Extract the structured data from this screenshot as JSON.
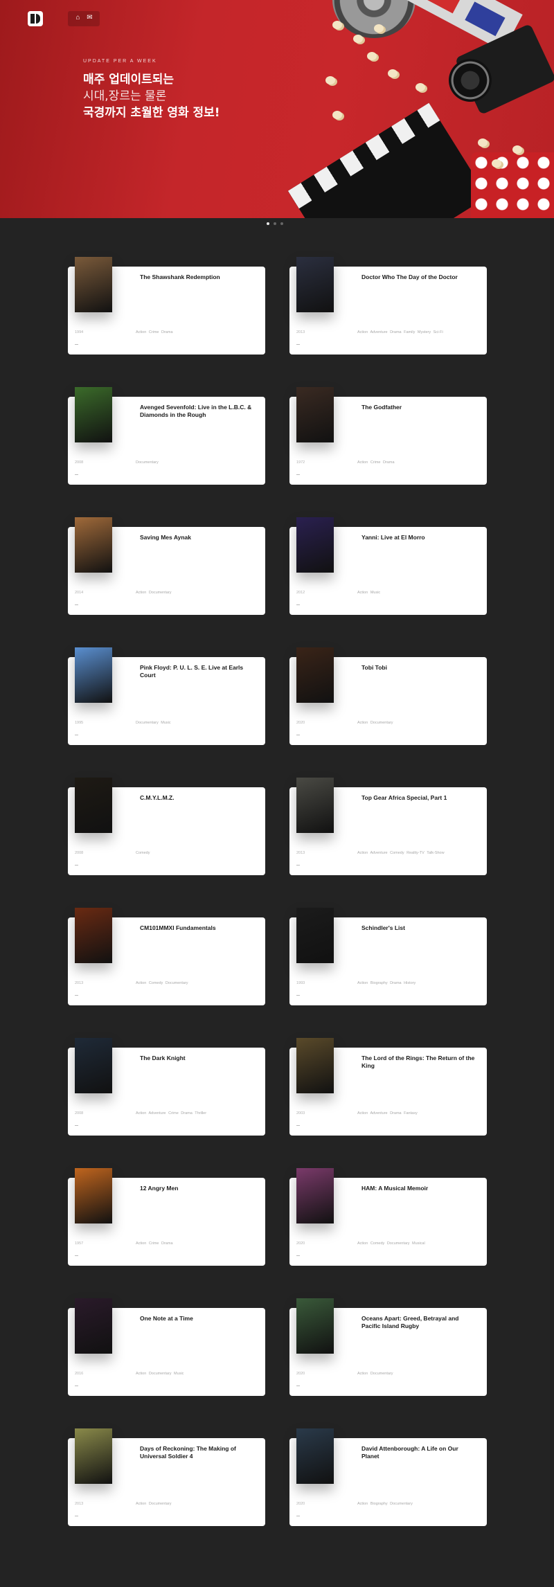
{
  "hero": {
    "kicker": "UPDATE PER A WEEK",
    "line1": "매주 업데이트되는",
    "line2": "시대,장르는 물론",
    "line3": "국경까지 초월한 영화 정보!",
    "background_color": "#c4262a"
  },
  "nav": {
    "icons": [
      "home-icon",
      "mail-icon"
    ]
  },
  "slider": {
    "count": 3,
    "active": 0
  },
  "movies": [
    {
      "title": "The Shawshank Redemption",
      "year": "1994",
      "genres": "Action  Crime  Drama",
      "poster_color": "#7a5a3a"
    },
    {
      "title": "Doctor Who The Day of the Doctor",
      "year": "2013",
      "genres": "Action  Adventure  Drama  Family  Mystery  Sci-Fi",
      "poster_color": "#2b2f3f"
    },
    {
      "title": "Avenged Sevenfold: Live in the L.B.C. & Diamonds in the Rough",
      "year": "2008",
      "genres": "Documentary",
      "poster_color": "#3b6b2a"
    },
    {
      "title": "The Godfather",
      "year": "1972",
      "genres": "Action  Crime  Drama",
      "poster_color": "#3a2a22"
    },
    {
      "title": "Saving Mes Aynak",
      "year": "2014",
      "genres": "Action  Documentary",
      "poster_color": "#a06a3a"
    },
    {
      "title": "Yanni: Live at El Morro",
      "year": "2012",
      "genres": "Action  Music",
      "poster_color": "#2a2050"
    },
    {
      "title": "Pink Floyd: P. U. L. S. E. Live at Earls Court",
      "year": "1995",
      "genres": "Documentary  Music",
      "poster_color": "#5a8fd0"
    },
    {
      "title": "Tobi Tobi",
      "year": "2020",
      "genres": "Action  Documentary",
      "poster_color": "#3a2418"
    },
    {
      "title": "C.M.Y.L.M.Z.",
      "year": "2008",
      "genres": "Comedy",
      "poster_color": "#1e1a14"
    },
    {
      "title": "Top Gear Africa Special, Part 1",
      "year": "2013",
      "genres": "Action  Adventure  Comedy  Reality-TV  Talk-Show",
      "poster_color": "#4a4a44"
    },
    {
      "title": "CM101MMXI Fundamentals",
      "year": "2013",
      "genres": "Action  Comedy  Documentary",
      "poster_color": "#6a2a12"
    },
    {
      "title": "Schindler's List",
      "year": "1993",
      "genres": "Action  Biography  Drama  History",
      "poster_color": "#1b1b1b"
    },
    {
      "title": "The Dark Knight",
      "year": "2008",
      "genres": "Action  Adventure  Crime  Drama  Thriller",
      "poster_color": "#1f2a38"
    },
    {
      "title": "The Lord of the Rings: The Return of the King",
      "year": "2003",
      "genres": "Action  Adventure  Drama  Fantasy",
      "poster_color": "#5a4a2a"
    },
    {
      "title": "12 Angry Men",
      "year": "1957",
      "genres": "Action  Crime  Drama",
      "poster_color": "#c0651e"
    },
    {
      "title": "HAM: A Musical Memoir",
      "year": "2020",
      "genres": "Action  Comedy  Documentary  Musical",
      "poster_color": "#7a3a6a"
    },
    {
      "title": "One Note at a Time",
      "year": "2016",
      "genres": "Action  Documentary  Music",
      "poster_color": "#2a1a2a"
    },
    {
      "title": "Oceans Apart: Greed, Betrayal and Pacific Island Rugby",
      "year": "2020",
      "genres": "Action  Documentary",
      "poster_color": "#3a5a3a"
    },
    {
      "title": "Days of Reckoning: The Making of Universal Soldier 4",
      "year": "2013",
      "genres": "Action  Documentary",
      "poster_color": "#8a8a4a"
    },
    {
      "title": "David Attenborough: A Life on Our Planet",
      "year": "2020",
      "genres": "Action  Biography  Documentary",
      "poster_color": "#2a3a4a"
    }
  ]
}
